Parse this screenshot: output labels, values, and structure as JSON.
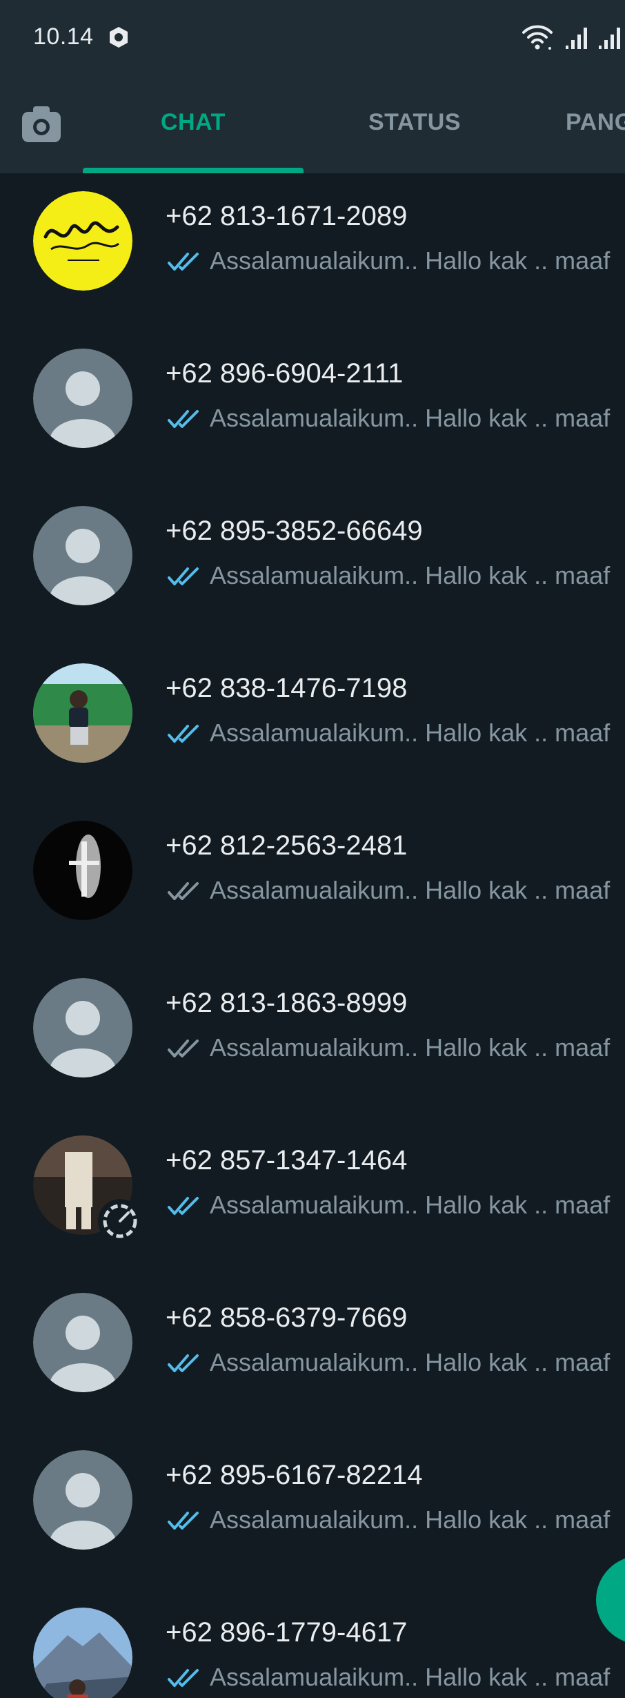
{
  "status_bar": {
    "time": "10.14"
  },
  "tabs": {
    "camera_icon": "camera-icon",
    "items": [
      {
        "label": "CHAT",
        "active": true
      },
      {
        "label": "STATUS",
        "active": false
      },
      {
        "label": "PANGGILAN",
        "active": false
      }
    ]
  },
  "colors": {
    "accent": "#00a884",
    "header_bg": "#1f2c34",
    "list_bg": "#121b22",
    "read_tick": "#53bdeb",
    "delivered_tick": "#8696a0"
  },
  "chats": [
    {
      "name": "+62 813-1671-2089",
      "preview": "Assalamualaikum.. Hallo kak .. maaf",
      "tick": "read",
      "avatar": "calligraphy"
    },
    {
      "name": "+62 896-6904-2111",
      "preview": "Assalamualaikum.. Hallo kak .. maaf",
      "tick": "read",
      "avatar": "default"
    },
    {
      "name": "+62 895-3852-66649",
      "preview": "Assalamualaikum.. Hallo kak .. maaf",
      "tick": "read",
      "avatar": "default"
    },
    {
      "name": "+62 838-1476-7198",
      "preview": "Assalamualaikum.. Hallo kak .. maaf",
      "tick": "read",
      "avatar": "photo-outdoor"
    },
    {
      "name": "+62 812-2563-2481",
      "preview": "Assalamualaikum.. Hallo kak .. maaf",
      "tick": "delivered",
      "avatar": "photo-dark"
    },
    {
      "name": "+62 813-1863-8999",
      "preview": "Assalamualaikum.. Hallo kak .. maaf",
      "tick": "delivered",
      "avatar": "default"
    },
    {
      "name": "+62 857-1347-1464",
      "preview": "Assalamualaikum.. Hallo kak .. maaf",
      "tick": "read",
      "avatar": "photo-person",
      "has_status": true
    },
    {
      "name": "+62 858-6379-7669",
      "preview": "Assalamualaikum.. Hallo kak .. maaf",
      "tick": "read",
      "avatar": "default"
    },
    {
      "name": "+62 895-6167-82214",
      "preview": "Assalamualaikum.. Hallo kak .. maaf",
      "tick": "read",
      "avatar": "default"
    },
    {
      "name": "+62 896-1779-4617",
      "preview": "Assalamualaikum.. Hallo kak .. maaf",
      "tick": "read",
      "avatar": "photo-mountain"
    }
  ]
}
